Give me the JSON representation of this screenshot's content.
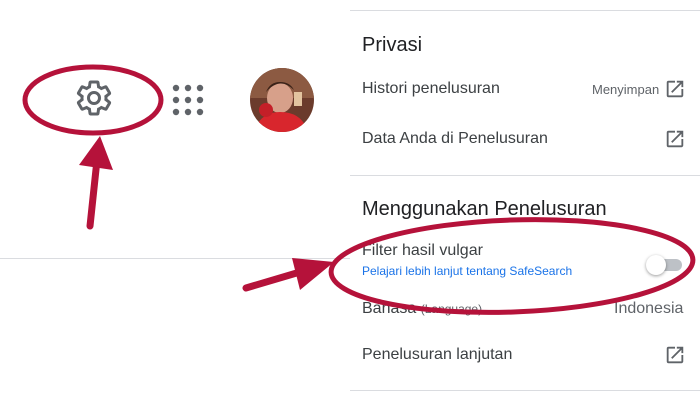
{
  "toolbar": {
    "settings_icon": "gear-icon",
    "apps_icon": "apps-grid-icon",
    "avatar_alt": "account-avatar"
  },
  "panel": {
    "privacy": {
      "title": "Privasi",
      "history_label": "Histori penelusuran",
      "history_status": "Menyimpan",
      "your_data_label": "Data Anda di Penelusuran"
    },
    "using_search": {
      "title": "Menggunakan Penelusuran",
      "safesearch_label": "Filter hasil vulgar",
      "safesearch_link": "Pelajari lebih lanjut tentang SafeSearch",
      "safesearch_enabled": false,
      "language_label": "Bahasa",
      "language_sub": "(Language)",
      "language_value": "Indonesia",
      "advanced_label": "Penelusuran lanjutan"
    }
  },
  "colors": {
    "annotation": "#b5123a",
    "link": "#1a73e8",
    "divider": "#dadce0"
  }
}
